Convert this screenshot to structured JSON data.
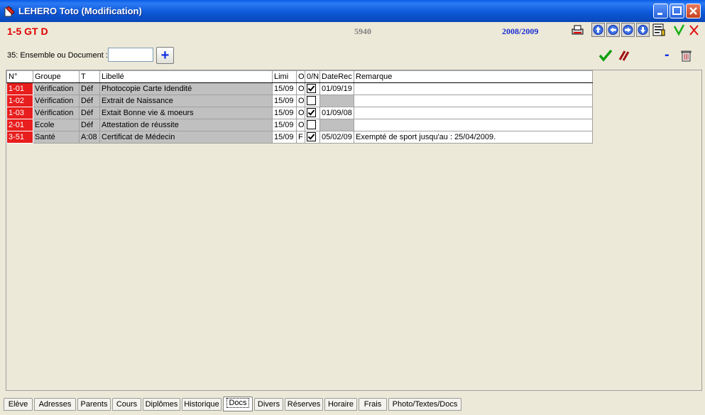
{
  "window": {
    "title": "LEHERO Toto (Modification)"
  },
  "infobar": {
    "class_code": "1-5 GT D",
    "record_number": "5940",
    "school_year": "2008/2009"
  },
  "filter": {
    "label": "35: Ensemble ou Document :",
    "value": "",
    "add_label": "+",
    "remove_label": "-"
  },
  "table": {
    "headers": [
      "N°",
      "Groupe",
      "T",
      "Libellé",
      "Limi",
      "O",
      "0/N",
      "DateRec",
      "Remarque"
    ],
    "rows": [
      {
        "num": "1-01",
        "groupe": "Vérification",
        "t": "Déf",
        "libelle": "Photocopie Carte Idendité",
        "limi": "15/09",
        "o": "O",
        "checked": true,
        "daterec": "01/09/19",
        "remarque": ""
      },
      {
        "num": "1-02",
        "groupe": "Vérification",
        "t": "Déf",
        "libelle": "Extrait de Naissance",
        "limi": "15/09",
        "o": "O",
        "checked": false,
        "daterec": "",
        "remarque": ""
      },
      {
        "num": "1-03",
        "groupe": "Vérification",
        "t": "Déf",
        "libelle": "Extait Bonne vie & moeurs",
        "limi": "15/09",
        "o": "O",
        "checked": true,
        "daterec": "01/09/08",
        "remarque": ""
      },
      {
        "num": "2-01",
        "groupe": "Ecole",
        "t": "Déf",
        "libelle": "Attestation de réussite",
        "limi": "15/09",
        "o": "O",
        "checked": false,
        "daterec": "",
        "remarque": ""
      },
      {
        "num": "3-51",
        "groupe": "Santé",
        "t": "A:08",
        "libelle": "Certificat de Médecin",
        "limi": "15/09",
        "o": "F",
        "checked": true,
        "daterec": "05/02/09",
        "remarque": "Exempté de sport jusqu'au : 25/04/2009."
      }
    ]
  },
  "tabs": [
    {
      "label": "Elève",
      "active": false
    },
    {
      "label": "Adresses",
      "active": false
    },
    {
      "label": "Parents",
      "active": false
    },
    {
      "label": "Cours",
      "active": false
    },
    {
      "label": "Diplômes",
      "active": false
    },
    {
      "label": "Historique",
      "active": false
    },
    {
      "label": "Docs",
      "active": true
    },
    {
      "label": "Divers",
      "active": false
    },
    {
      "label": "Réserves",
      "active": false
    },
    {
      "label": "Horaire",
      "active": false
    },
    {
      "label": "Frais",
      "active": false
    },
    {
      "label": "Photo/Textes/Docs",
      "active": false
    }
  ],
  "colors": {
    "titlebar": "#0a5ce6",
    "class_code": "#e00000",
    "record_number": "#808080",
    "school_year": "#1a2ed0",
    "row_number_bg": "#e81e1e",
    "row_shade": "#c0c0c0",
    "validate": "#10a010",
    "cancel": "#a01010"
  },
  "icons": [
    "app-icon",
    "print-icon",
    "first-record-icon",
    "prev-record-icon",
    "next-record-icon",
    "last-record-icon",
    "notes-icon",
    "save-check-icon",
    "cancel-x-icon",
    "validate-check-icon",
    "unvalidate-icon",
    "trash-icon",
    "minimize-icon",
    "maximize-icon",
    "close-icon"
  ]
}
